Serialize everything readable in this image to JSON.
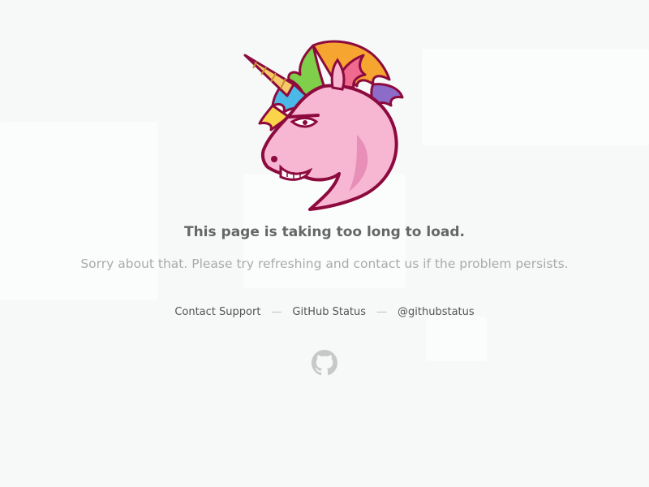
{
  "error": {
    "title": "This page is taking too long to load.",
    "message": "Sorry about that. Please try refreshing and contact us if the problem persists."
  },
  "links": {
    "contact_support": "Contact Support",
    "github_status": "GitHub Status",
    "twitter": "@githubstatus",
    "separator": "—"
  },
  "icons": {
    "hero": "unicorn-icon",
    "footer": "github-octocat-icon"
  },
  "colors": {
    "background": "#f7f8f8",
    "title": "#666666",
    "message": "#aaaaaa",
    "link": "#555555",
    "unicorn_pink": "#f7b7d2",
    "unicorn_outline": "#8c0a3d",
    "octocat": "#c8c8c8"
  }
}
